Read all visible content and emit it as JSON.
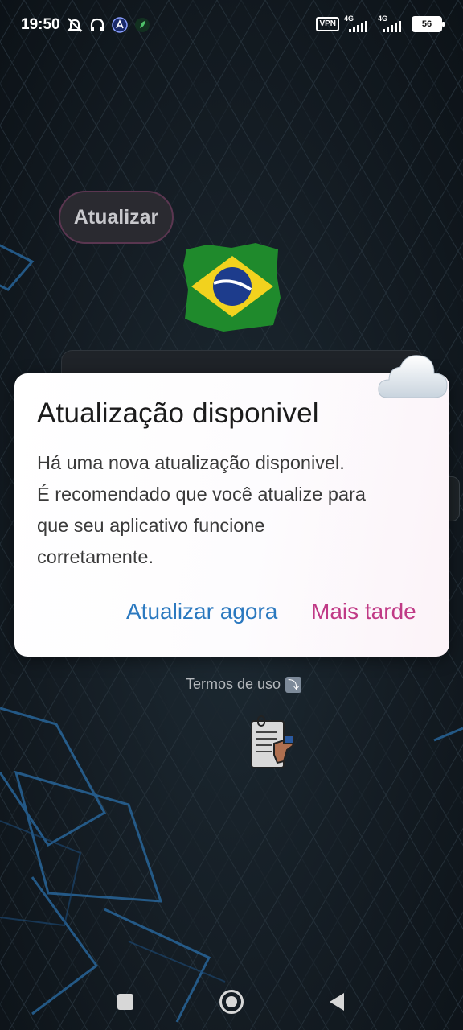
{
  "status_bar": {
    "time": "19:50",
    "vpn": "VPN",
    "network1": "4G",
    "network2": "4G",
    "battery": "56"
  },
  "app": {
    "update_button": "Atualizar",
    "terms_label": "Termos de uso"
  },
  "dialog": {
    "title": "Atualização disponivel",
    "message_lines": [
      "Há uma nova atualização disponivel.",
      "É recomendado que você atualize para",
      "que seu aplicativo funcione",
      "corretamente."
    ],
    "update_now": "Atualizar agora",
    "later": "Mais tarde"
  },
  "colors": {
    "accent_blue": "#2a78bf",
    "accent_pink": "#c03a86"
  }
}
